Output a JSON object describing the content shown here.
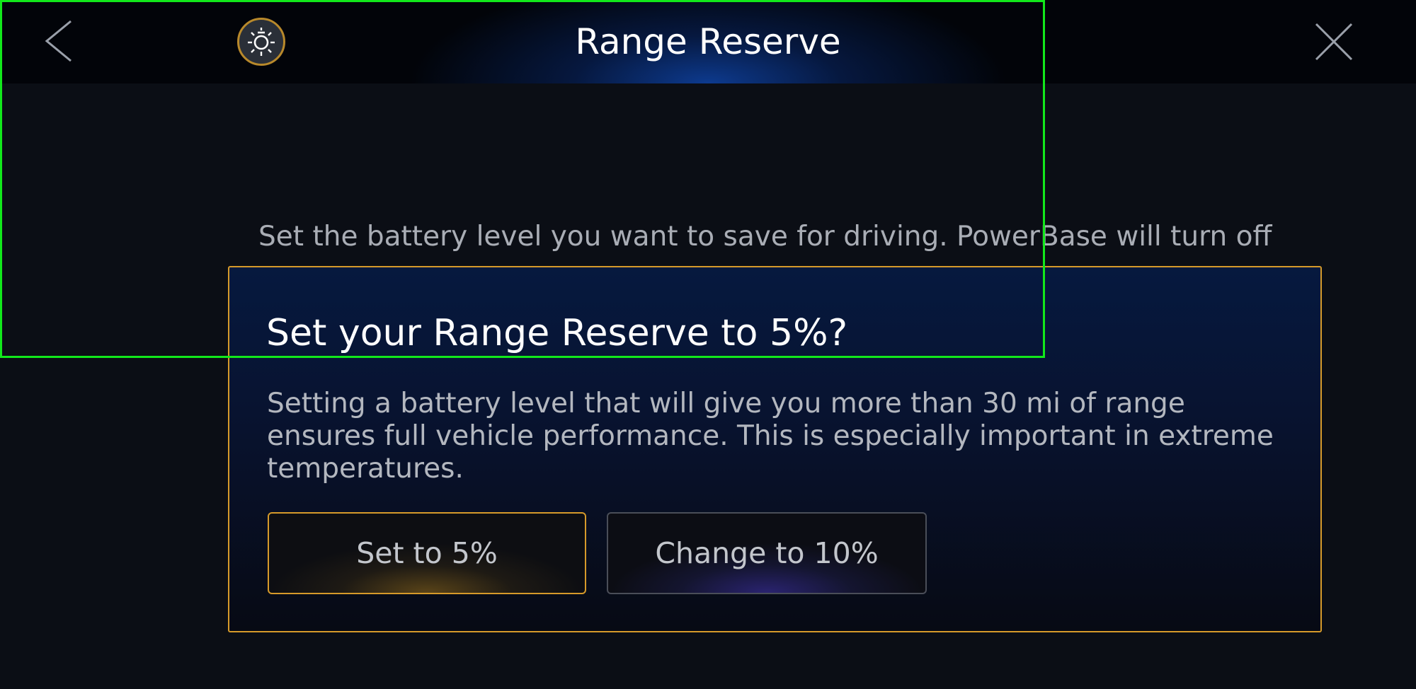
{
  "header": {
    "title": "Range Reserve",
    "back_icon": "chevron-left-icon",
    "mode_icon": "sun-bulb-icon",
    "close_icon": "close-icon"
  },
  "main": {
    "description": "Set the battery level you want to save for driving. PowerBase will turn off"
  },
  "dialog": {
    "title": "Set your Range Reserve to 5%?",
    "body": "Setting a battery level that will give you more than 30 mi of range ensures full vehicle performance. This is especially important in extreme temperatures.",
    "primary_label": "Set to 5%",
    "secondary_label": "Change to 10%"
  },
  "colors": {
    "accent": "#d69a2a",
    "background": "#0b0e15",
    "header_glow": "#0d3a8e",
    "highlight": "#12e81b"
  }
}
